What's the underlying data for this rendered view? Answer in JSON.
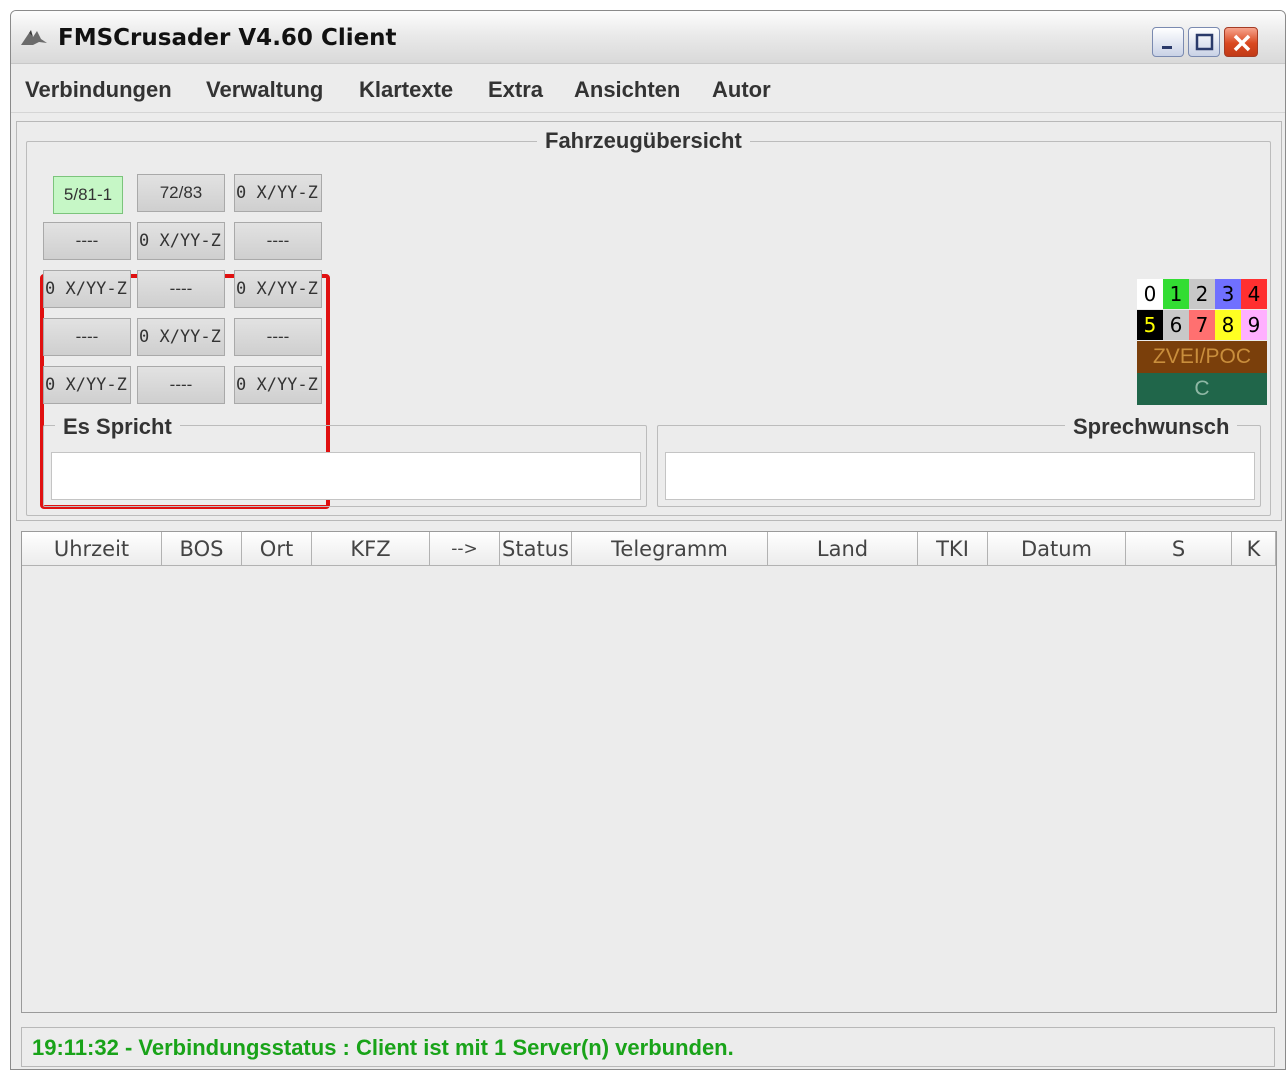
{
  "window": {
    "title": "FMSCrusader V4.60 Client"
  },
  "menu": [
    {
      "label": "Verbindungen"
    },
    {
      "label": "Verwaltung"
    },
    {
      "label": "Klartexte"
    },
    {
      "label": "Extra"
    },
    {
      "label": "Ansichten"
    },
    {
      "label": "Autor"
    }
  ],
  "overview": {
    "title": "Fahrzeugübersicht",
    "vehicles": [
      [
        "5/81-1",
        "72/83",
        "0 X/YY-Z"
      ],
      [
        "----",
        "0 X/YY-Z",
        "----"
      ],
      [
        "0 X/YY-Z",
        "----",
        "0 X/YY-Z"
      ],
      [
        "----",
        "0 X/YY-Z",
        "----"
      ],
      [
        "0 X/YY-Z",
        "----",
        "0 X/YY-Z"
      ]
    ],
    "active_vehicle": "5/81-1",
    "status_legend": {
      "digits": [
        "0",
        "1",
        "2",
        "3",
        "4",
        "5",
        "6",
        "7",
        "8",
        "9"
      ],
      "colors": [
        "#ffffff",
        "#33dd33",
        "#c8c8c8",
        "#7070ff",
        "#ff3030",
        "#000000",
        "#c8c8c8",
        "#ff7070",
        "#ffff22",
        "#ffb0ff"
      ],
      "text_colors": [
        "#000000",
        "#000000",
        "#000000",
        "#000000",
        "#000000",
        "#ffff00",
        "#000000",
        "#000000",
        "#000000",
        "#000000"
      ],
      "zvei_label": "ZVEI/POC",
      "c_label": "C"
    }
  },
  "speaking": {
    "label": "Es Spricht",
    "value": ""
  },
  "request": {
    "label": "Sprechwunsch",
    "value": ""
  },
  "table": {
    "columns": [
      "Uhrzeit",
      "BOS",
      "Ort",
      "KFZ",
      "-->",
      "Status",
      "Telegramm",
      "Land",
      "TKI",
      "Datum",
      "S",
      "K"
    ],
    "rows": []
  },
  "status": {
    "message": "19:11:32 - Verbindungsstatus : Client ist mit 1 Server(n) verbunden."
  }
}
